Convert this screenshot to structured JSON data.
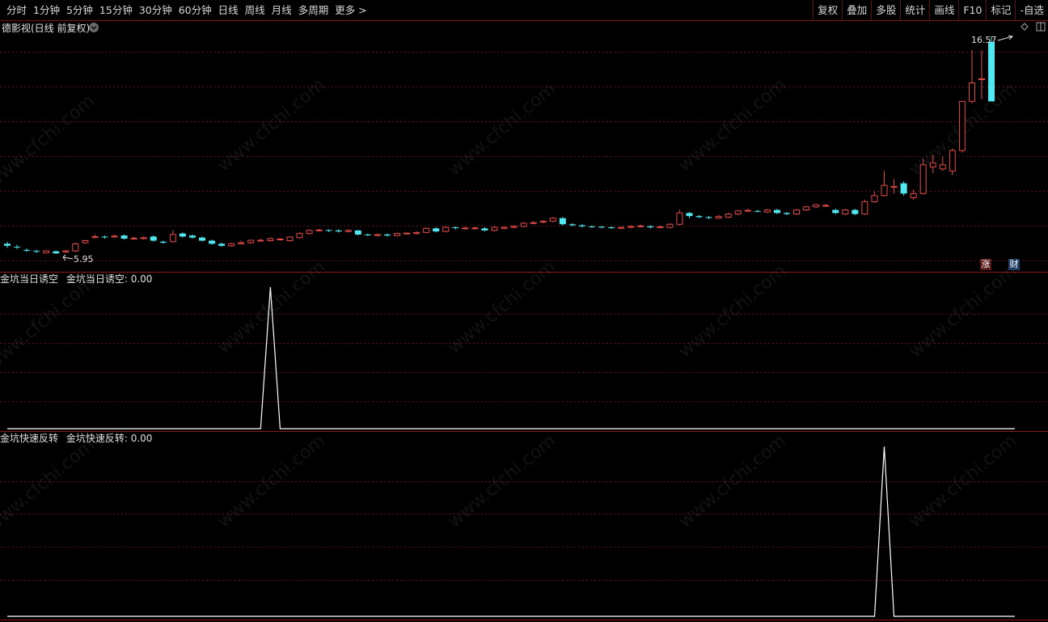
{
  "toolbar": {
    "periods": [
      "分时",
      "1分钟",
      "5分钟",
      "15分钟",
      "30分钟",
      "60分钟",
      "日线",
      "周线",
      "月线",
      "多周期",
      "更多 >"
    ],
    "tools": [
      "复权",
      "叠加",
      "多股",
      "统计",
      "画线",
      "F10",
      "标记",
      "-自选"
    ]
  },
  "main_panel": {
    "title": "德影视(日线 前复权)",
    "high_label": "16.57",
    "low_label": "5.95",
    "badge_zhang": "涨",
    "badge_cai": "财"
  },
  "indicator1": {
    "name": "金坑当日诱空",
    "value_text": "金坑当日诱空: 0.00"
  },
  "indicator2": {
    "name": "金坑快速反转",
    "value_text": "金坑快速反转: 0.00"
  },
  "watermark": "www.cfchi.com",
  "colors": {
    "up": "#e24a48",
    "down": "#52e8f2",
    "grid": "#5a1414",
    "border": "#8a1a1a",
    "background": "#000000"
  },
  "chart_data": [
    {
      "type": "candlestick",
      "title": "德影视(日线 前复权)",
      "annotations": [
        "16.57",
        "5.95"
      ],
      "candles": [
        {
          "o": 6.45,
          "c": 6.35,
          "h": 6.55,
          "l": 6.25
        },
        {
          "o": 6.3,
          "c": 6.28,
          "h": 6.4,
          "l": 6.2
        },
        {
          "o": 6.15,
          "c": 6.13,
          "h": 6.22,
          "l": 6.05
        },
        {
          "o": 6.1,
          "c": 6.08,
          "h": 6.15,
          "l": 6.0
        },
        {
          "o": 6.0,
          "c": 6.1,
          "h": 6.15,
          "l": 5.98
        },
        {
          "o": 6.08,
          "c": 5.98,
          "h": 6.12,
          "l": 5.95
        },
        {
          "o": 6.05,
          "c": 6.1,
          "h": 6.15,
          "l": 6.0
        },
        {
          "o": 6.1,
          "c": 6.45,
          "h": 6.5,
          "l": 6.05
        },
        {
          "o": 6.5,
          "c": 6.6,
          "h": 6.65,
          "l": 6.45
        },
        {
          "o": 6.75,
          "c": 6.8,
          "h": 6.9,
          "l": 6.7
        },
        {
          "o": 6.8,
          "c": 6.78,
          "h": 6.85,
          "l": 6.7
        },
        {
          "o": 6.8,
          "c": 6.82,
          "h": 6.9,
          "l": 6.75
        },
        {
          "o": 6.85,
          "c": 6.7,
          "h": 6.9,
          "l": 6.65
        },
        {
          "o": 6.7,
          "c": 6.72,
          "h": 6.8,
          "l": 6.65
        },
        {
          "o": 6.7,
          "c": 6.75,
          "h": 6.8,
          "l": 6.65
        },
        {
          "o": 6.8,
          "c": 6.6,
          "h": 6.85,
          "l": 6.55
        },
        {
          "o": 6.55,
          "c": 6.5,
          "h": 6.6,
          "l": 6.45
        },
        {
          "o": 6.55,
          "c": 6.9,
          "h": 7.1,
          "l": 6.5
        },
        {
          "o": 6.95,
          "c": 6.8,
          "h": 7.0,
          "l": 6.75
        },
        {
          "o": 6.85,
          "c": 6.75,
          "h": 6.9,
          "l": 6.7
        },
        {
          "o": 6.75,
          "c": 6.6,
          "h": 6.8,
          "l": 6.55
        },
        {
          "o": 6.6,
          "c": 6.45,
          "h": 6.65,
          "l": 6.4
        },
        {
          "o": 6.45,
          "c": 6.35,
          "h": 6.5,
          "l": 6.3
        },
        {
          "o": 6.35,
          "c": 6.45,
          "h": 6.5,
          "l": 6.3
        },
        {
          "o": 6.45,
          "c": 6.5,
          "h": 6.6,
          "l": 6.4
        },
        {
          "o": 6.5,
          "c": 6.62,
          "h": 6.65,
          "l": 6.45
        },
        {
          "o": 6.6,
          "c": 6.62,
          "h": 6.7,
          "l": 6.55
        },
        {
          "o": 6.6,
          "c": 6.7,
          "h": 6.75,
          "l": 6.55
        },
        {
          "o": 6.65,
          "c": 6.68,
          "h": 6.72,
          "l": 6.6
        },
        {
          "o": 6.6,
          "c": 6.78,
          "h": 6.82,
          "l": 6.55
        },
        {
          "o": 6.75,
          "c": 6.95,
          "h": 7.0,
          "l": 6.7
        },
        {
          "o": 6.95,
          "c": 7.1,
          "h": 7.15,
          "l": 6.9
        },
        {
          "o": 7.1,
          "c": 7.12,
          "h": 7.18,
          "l": 7.05
        },
        {
          "o": 7.12,
          "c": 7.08,
          "h": 7.15,
          "l": 7.02
        },
        {
          "o": 7.1,
          "c": 7.05,
          "h": 7.15,
          "l": 7.0
        },
        {
          "o": 7.05,
          "c": 7.1,
          "h": 7.15,
          "l": 7.0
        },
        {
          "o": 7.1,
          "c": 6.9,
          "h": 7.12,
          "l": 6.85
        },
        {
          "o": 6.9,
          "c": 6.88,
          "h": 6.95,
          "l": 6.82
        },
        {
          "o": 6.85,
          "c": 6.9,
          "h": 6.95,
          "l": 6.8
        },
        {
          "o": 6.9,
          "c": 6.85,
          "h": 6.95,
          "l": 6.8
        },
        {
          "o": 6.85,
          "c": 6.95,
          "h": 7.0,
          "l": 6.8
        },
        {
          "o": 6.95,
          "c": 6.97,
          "h": 7.0,
          "l": 6.9
        },
        {
          "o": 6.95,
          "c": 7.0,
          "h": 7.05,
          "l": 6.9
        },
        {
          "o": 7.0,
          "c": 7.2,
          "h": 7.25,
          "l": 6.95
        },
        {
          "o": 7.2,
          "c": 7.05,
          "h": 7.25,
          "l": 7.0
        },
        {
          "o": 7.05,
          "c": 7.25,
          "h": 7.3,
          "l": 7.0
        },
        {
          "o": 7.25,
          "c": 7.22,
          "h": 7.3,
          "l": 7.15
        },
        {
          "o": 7.2,
          "c": 7.22,
          "h": 7.28,
          "l": 7.15
        },
        {
          "o": 7.2,
          "c": 7.22,
          "h": 7.28,
          "l": 7.15
        },
        {
          "o": 7.2,
          "c": 7.1,
          "h": 7.25,
          "l": 7.05
        },
        {
          "o": 7.1,
          "c": 7.25,
          "h": 7.3,
          "l": 7.05
        },
        {
          "o": 7.2,
          "c": 7.25,
          "h": 7.3,
          "l": 7.15
        },
        {
          "o": 7.25,
          "c": 7.3,
          "h": 7.35,
          "l": 7.2
        },
        {
          "o": 7.3,
          "c": 7.45,
          "h": 7.5,
          "l": 7.25
        },
        {
          "o": 7.45,
          "c": 7.48,
          "h": 7.55,
          "l": 7.4
        },
        {
          "o": 7.5,
          "c": 7.55,
          "h": 7.6,
          "l": 7.45
        },
        {
          "o": 7.55,
          "c": 7.7,
          "h": 7.75,
          "l": 7.5
        },
        {
          "o": 7.7,
          "c": 7.4,
          "h": 7.75,
          "l": 7.35
        },
        {
          "o": 7.4,
          "c": 7.35,
          "h": 7.45,
          "l": 7.3
        },
        {
          "o": 7.35,
          "c": 7.3,
          "h": 7.4,
          "l": 7.25
        },
        {
          "o": 7.3,
          "c": 7.28,
          "h": 7.35,
          "l": 7.22
        },
        {
          "o": 7.28,
          "c": 7.25,
          "h": 7.32,
          "l": 7.2
        },
        {
          "o": 7.25,
          "c": 7.22,
          "h": 7.3,
          "l": 7.18
        },
        {
          "o": 7.2,
          "c": 7.25,
          "h": 7.3,
          "l": 7.15
        },
        {
          "o": 7.25,
          "c": 7.3,
          "h": 7.35,
          "l": 7.2
        },
        {
          "o": 7.3,
          "c": 7.32,
          "h": 7.38,
          "l": 7.25
        },
        {
          "o": 7.3,
          "c": 7.25,
          "h": 7.35,
          "l": 7.2
        },
        {
          "o": 7.25,
          "c": 7.28,
          "h": 7.32,
          "l": 7.2
        },
        {
          "o": 7.25,
          "c": 7.4,
          "h": 7.45,
          "l": 7.2
        },
        {
          "o": 7.4,
          "c": 7.95,
          "h": 8.1,
          "l": 7.35
        },
        {
          "o": 7.95,
          "c": 7.8,
          "h": 8.0,
          "l": 7.7
        },
        {
          "o": 7.8,
          "c": 7.75,
          "h": 7.85,
          "l": 7.7
        },
        {
          "o": 7.75,
          "c": 7.72,
          "h": 7.8,
          "l": 7.65
        },
        {
          "o": 7.7,
          "c": 7.78,
          "h": 7.85,
          "l": 7.65
        },
        {
          "o": 7.75,
          "c": 7.9,
          "h": 7.95,
          "l": 7.7
        },
        {
          "o": 7.9,
          "c": 8.05,
          "h": 8.1,
          "l": 7.85
        },
        {
          "o": 8.05,
          "c": 8.08,
          "h": 8.15,
          "l": 8.0
        },
        {
          "o": 8.05,
          "c": 8.03,
          "h": 8.1,
          "l": 7.98
        },
        {
          "o": 8.0,
          "c": 8.1,
          "h": 8.15,
          "l": 7.95
        },
        {
          "o": 8.1,
          "c": 7.95,
          "h": 8.15,
          "l": 7.9
        },
        {
          "o": 7.95,
          "c": 7.9,
          "h": 8.0,
          "l": 7.85
        },
        {
          "o": 7.9,
          "c": 8.1,
          "h": 8.15,
          "l": 7.85
        },
        {
          "o": 8.1,
          "c": 8.25,
          "h": 8.3,
          "l": 8.05
        },
        {
          "o": 8.25,
          "c": 8.35,
          "h": 8.4,
          "l": 8.2
        },
        {
          "o": 8.3,
          "c": 8.32,
          "h": 8.4,
          "l": 8.25
        },
        {
          "o": 8.1,
          "c": 7.95,
          "h": 8.15,
          "l": 7.9
        },
        {
          "o": 7.9,
          "c": 8.1,
          "h": 8.15,
          "l": 7.85
        },
        {
          "o": 8.1,
          "c": 7.9,
          "h": 8.15,
          "l": 7.85
        },
        {
          "o": 7.9,
          "c": 8.5,
          "h": 8.6,
          "l": 7.85
        },
        {
          "o": 8.5,
          "c": 8.8,
          "h": 9.0,
          "l": 8.45
        },
        {
          "o": 8.8,
          "c": 9.3,
          "h": 10.0,
          "l": 8.75
        },
        {
          "o": 9.2,
          "c": 9.25,
          "h": 9.6,
          "l": 8.9
        },
        {
          "o": 9.4,
          "c": 8.9,
          "h": 9.5,
          "l": 8.8
        },
        {
          "o": 8.7,
          "c": 8.9,
          "h": 9.1,
          "l": 8.6
        },
        {
          "o": 8.9,
          "c": 10.3,
          "h": 10.6,
          "l": 8.85
        },
        {
          "o": 10.2,
          "c": 10.4,
          "h": 10.8,
          "l": 9.9
        },
        {
          "o": 10.1,
          "c": 10.3,
          "h": 10.7,
          "l": 10.0
        },
        {
          "o": 10.0,
          "c": 11.0,
          "h": 11.1,
          "l": 9.8
        },
        {
          "o": 11.0,
          "c": 13.4,
          "h": 13.4,
          "l": 10.9
        },
        {
          "o": 13.4,
          "c": 14.3,
          "h": 15.9,
          "l": 13.3
        },
        {
          "o": 14.5,
          "c": 14.5,
          "h": 15.9,
          "l": 13.5
        },
        {
          "o": 16.3,
          "c": 13.4,
          "h": 16.57,
          "l": 13.4
        }
      ]
    },
    {
      "type": "line",
      "title": "金坑当日诱空",
      "ylim": [
        0,
        1
      ],
      "length": 102,
      "spikes": [
        {
          "index": 27,
          "value": 1
        }
      ]
    },
    {
      "type": "line",
      "title": "金坑快速反转",
      "ylim": [
        0,
        1
      ],
      "length": 102,
      "spikes": [
        {
          "index": 90,
          "value": 1
        }
      ]
    }
  ]
}
